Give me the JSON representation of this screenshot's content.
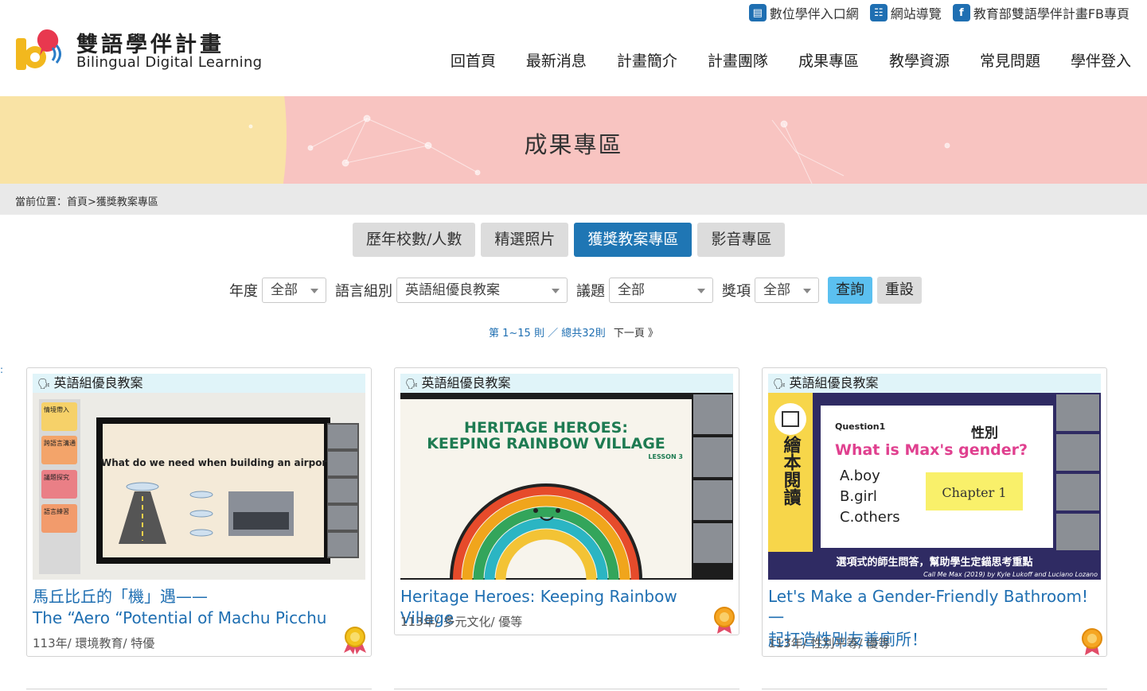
{
  "header": {
    "brand_zh": "雙語學伴計畫",
    "brand_en": "Bilingual Digital Learning",
    "toplinks": [
      {
        "label": "數位學伴入口網",
        "icon": "book-icon"
      },
      {
        "label": "網站導覽",
        "icon": "sitemap-icon"
      },
      {
        "label": "教育部雙語學伴計畫FB專頁",
        "icon": "facebook-icon"
      }
    ],
    "nav": [
      "回首頁",
      "最新消息",
      "計畫簡介",
      "計畫團隊",
      "成果專區",
      "教學資源",
      "常見問題",
      "學伴登入"
    ]
  },
  "banner": {
    "title": "成果專區"
  },
  "breadcrumb": "當前位置：首頁>獲獎教案專區",
  "tabs": [
    {
      "label": "歷年校數/人數",
      "active": false
    },
    {
      "label": "精選照片",
      "active": false
    },
    {
      "label": "獲獎教案專區",
      "active": true
    },
    {
      "label": "影音專區",
      "active": false
    }
  ],
  "filters": {
    "year_label": "年度",
    "year_value": "全部",
    "group_label": "語言組別",
    "group_value": "英語組優良教案",
    "topic_label": "議題",
    "topic_value": "全部",
    "award_label": "獎項",
    "award_value": "全部",
    "query_button": "查詢",
    "reset_button": "重設"
  },
  "pager": {
    "range": "第 1~15 則 ／ 總共32則",
    "next": "下一頁 》"
  },
  "cards": [
    {
      "category": "英語組優良教案",
      "title_line1": "馬丘比丘的「機」遇——",
      "title_line2": "The “Aero “Potential of Machu Picchu",
      "meta": "113年/ 環境教育/ 特優",
      "image": {
        "tags": [
          "情境帶入",
          "跨語言溝通",
          "議題探究",
          "語言練習"
        ],
        "question": "What do we need when building an airport?"
      }
    },
    {
      "category": "英語組優良教案",
      "title": "Heritage Heroes: Keeping Rainbow Village",
      "meta": "113年/ 多元文化/ 優等",
      "image": {
        "line1": "HERITAGE HEROES:",
        "line2": "KEEPING RAINBOW VILLAGE",
        "lesson": "LESSON 3"
      }
    },
    {
      "category": "英語組優良教案",
      "title_line1": "Let's Make a Gender-Friendly Bathroom! 一",
      "title_line2": "起打造性別友善廁所！",
      "meta": "113年/ 性別平等/ 優等",
      "image": {
        "side": "繪本閱讀",
        "q_label": "Question1",
        "q_zh": "性別",
        "q_text": "What is Max's gender?",
        "opt_a": "A.boy",
        "opt_b": "B.girl",
        "opt_c": "C.others",
        "chapter": "Chapter 1",
        "caption_zh": "選項式的師生問答，幫助學生定錨思考重點",
        "caption_en": "Call Me Max (2019) by Kyle Lukoff and Luciano Lozano"
      }
    }
  ],
  "colors": {
    "accent": "#1f76b4",
    "banner_pink": "#f8c4c1",
    "banner_yellow": "#f9e3a5",
    "link": "#1f6fb2"
  }
}
